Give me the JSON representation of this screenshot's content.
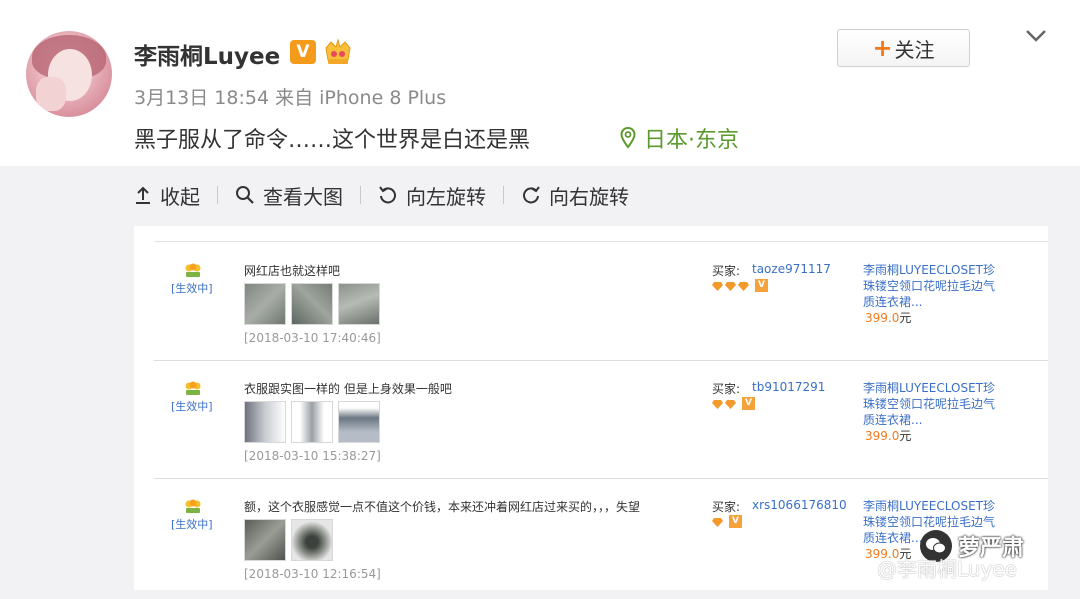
{
  "post": {
    "user_name": "李雨桐Luyee",
    "verified_badge": "V",
    "meta": "3月13日 18:54 来自 iPhone 8 Plus",
    "text": "黑子服从了命令……这个世界是白还是黑",
    "location": "日本·东京",
    "follow_label": "关注",
    "follow_plus": "+"
  },
  "toolbar": {
    "collapse_label": "收起",
    "view_large_label": "查看大图",
    "rotate_left_label": "向左旋转",
    "rotate_right_label": "向右旋转"
  },
  "reviews": [
    {
      "status": "[生效中]",
      "comment": "网红店也就这样吧",
      "date": "[2018-03-10 17:40:46]",
      "buyer_label": "买家:",
      "buyer_name": "taoze971117",
      "diamonds": 3,
      "product": "李雨桐LUYEECLOSET珍珠镂空领口花呢拉毛边气质连衣裙...",
      "price": "399.0",
      "currency": "元"
    },
    {
      "status": "[生效中]",
      "comment": "衣服跟实图一样的 但是上身效果一般吧",
      "date": "[2018-03-10 15:38:27]",
      "buyer_label": "买家:",
      "buyer_name": "tb91017291",
      "diamonds": 2,
      "product": "李雨桐LUYEECLOSET珍珠镂空领口花呢拉毛边气质连衣裙...",
      "price": "399.0",
      "currency": "元"
    },
    {
      "status": "[生效中]",
      "comment": "额，这个衣服感觉一点不值这个价钱，本来还冲着网红店过来买的，，，失望",
      "date": "[2018-03-10 12:16:54]",
      "buyer_label": "买家:",
      "buyer_name": "xrs1066176810",
      "diamonds": 1,
      "product": "李雨桐LUYEECLOSET珍珠镂空领口花呢拉毛边气质连衣裙...",
      "price": "399.0",
      "currency": "元"
    }
  ],
  "watermark": {
    "weibo_text": "@李雨桐Luyee",
    "account_name": "萝严肃"
  },
  "colors": {
    "accent_orange": "#f07a1c",
    "link_blue": "#3a6fc7",
    "location_green": "#5c9a2e"
  }
}
